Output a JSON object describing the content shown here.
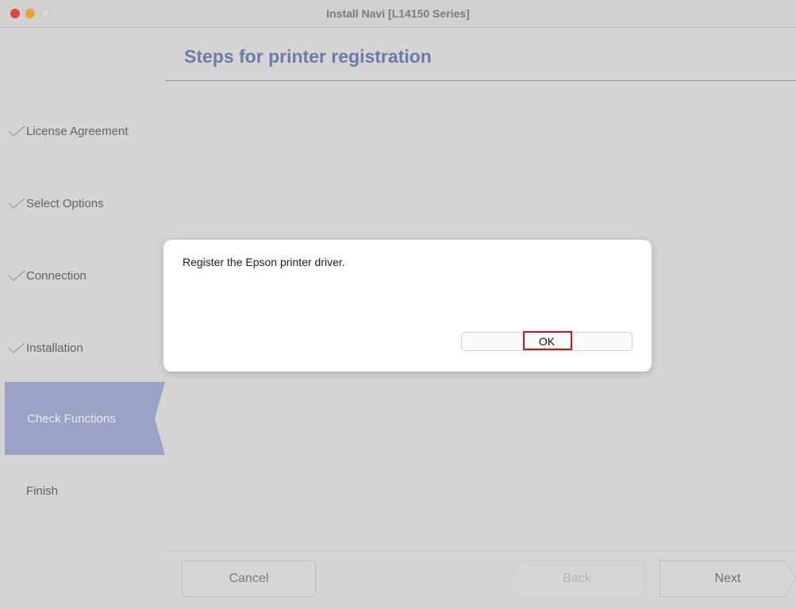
{
  "window": {
    "title": "Install Navi [L14150 Series]"
  },
  "header": {
    "title": "Steps for printer registration"
  },
  "sidebar": {
    "steps": [
      {
        "label": "License Agreement",
        "state": "completed",
        "icon": "checkmark-icon"
      },
      {
        "label": "Select Options",
        "state": "completed",
        "icon": "checkmark-icon"
      },
      {
        "label": "Connection",
        "state": "completed",
        "icon": "checkmark-icon"
      },
      {
        "label": "Installation",
        "state": "completed",
        "icon": "checkmark-icon"
      },
      {
        "label": "Check Functions",
        "state": "current"
      },
      {
        "label": "Finish",
        "state": "pending"
      }
    ]
  },
  "footer": {
    "cancel_label": "Cancel",
    "back_label": "Back",
    "next_label": "Next"
  },
  "dialog": {
    "message": "Register the Epson printer driver.",
    "ok_label": "OK"
  },
  "colors": {
    "accent": "#6c7aa7",
    "active_step": "#9aa3c6",
    "highlight_box": "#d6111a"
  }
}
